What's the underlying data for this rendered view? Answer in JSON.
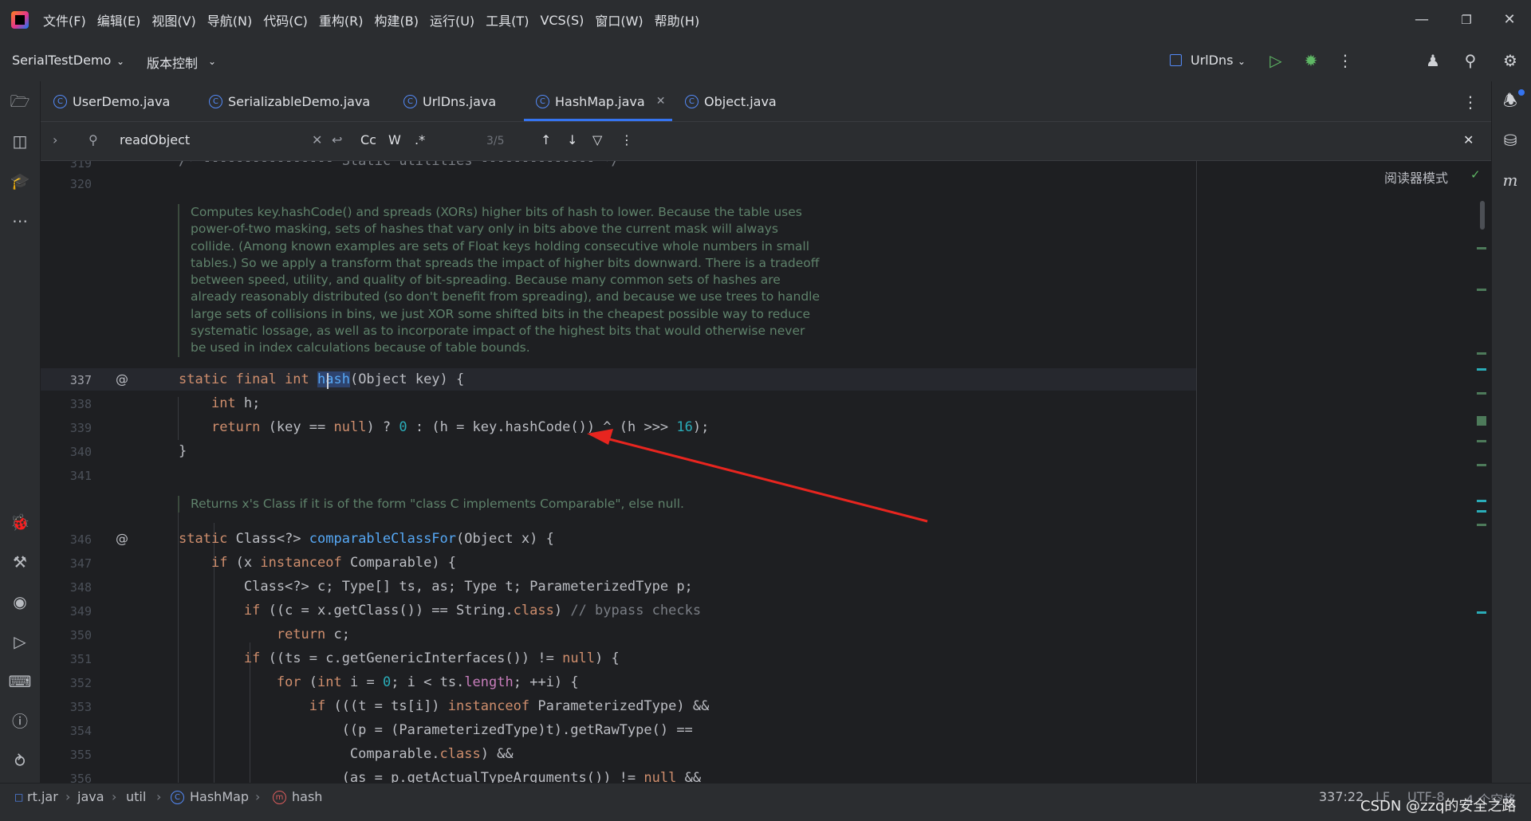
{
  "menu": [
    "文件(F)",
    "编辑(E)",
    "视图(V)",
    "导航(N)",
    "代码(C)",
    "重构(R)",
    "构建(B)",
    "运行(U)",
    "工具(T)",
    "VCS(S)",
    "窗口(W)",
    "帮助(H)"
  ],
  "toolbar": {
    "project": "SerialTestDemo",
    "vcs": "版本控制",
    "run_config": "UrlDns"
  },
  "tabs": [
    {
      "label": "UserDemo.java",
      "active": false
    },
    {
      "label": "SerializableDemo.java",
      "active": false
    },
    {
      "label": "UrlDns.java",
      "active": false
    },
    {
      "label": "HashMap.java",
      "active": true
    },
    {
      "label": "Object.java",
      "active": false
    }
  ],
  "find": {
    "query": "readObject",
    "case_label": "Cc",
    "word_label": "W",
    "regex_label": ".*",
    "count": "3/5"
  },
  "editor": {
    "reader_mode": "阅读器模式",
    "partial_line": "/* ---------------- Static utilities -------------- */",
    "doc1": "Computes key.hashCode() and spreads (XORs) higher bits of hash to lower. Because the table uses power-of-two masking, sets of hashes that vary only in bits above the current mask will always collide. (Among known examples are sets of Float keys holding consecutive whole numbers in small tables.) So we apply a transform that spreads the impact of higher bits downward. There is a tradeoff between speed, utility, and quality of bit-spreading. Because many common sets of hashes are already reasonably distributed (so don't benefit from spreading), and because we use trees to handle large sets of collisions in bins, we just XOR some shifted bits in the cheapest possible way to reduce systematic lossage, as well as to incorporate impact of the highest bits that would otherwise never be used in index calculations because of table bounds.",
    "doc2": "Returns x's Class if it is of the form \"class C implements Comparable\", else null.",
    "line_numbers": [
      "319",
      "320",
      "337",
      "338",
      "339",
      "340",
      "341",
      "346",
      "347",
      "348",
      "349",
      "350",
      "351",
      "352",
      "353",
      "354",
      "355",
      "356"
    ]
  },
  "breadcrumb": [
    "rt.jar",
    "java",
    "util",
    "HashMap",
    "hash"
  ],
  "status": {
    "position": "337:22",
    "line_sep": "LF",
    "encoding": "UTF-8",
    "indent": "4 个空格"
  },
  "watermark": "CSDN @zzq的安全之路",
  "colors": {
    "background": "#1e1f22",
    "panel": "#2b2d30",
    "accent": "#3574f0",
    "keyword": "#cf8e6d",
    "function": "#56a8f5",
    "number": "#2aacb8",
    "doc_comment": "#5f826b",
    "arrow": "#e8251f"
  }
}
